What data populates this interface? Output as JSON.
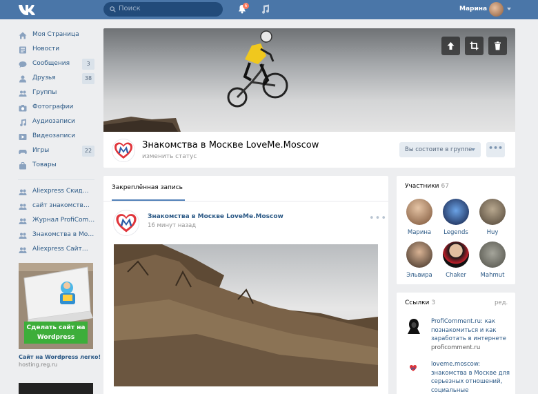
{
  "header": {
    "search_placeholder": "Поиск",
    "notifications_count": "6",
    "user_name": "Марина"
  },
  "left_menu": {
    "items": [
      {
        "label": "Моя Страница",
        "icon": "home-icon",
        "count": ""
      },
      {
        "label": "Новости",
        "icon": "news-icon",
        "count": ""
      },
      {
        "label": "Сообщения",
        "icon": "messages-icon",
        "count": "3"
      },
      {
        "label": "Друзья",
        "icon": "friends-icon",
        "count": "38"
      },
      {
        "label": "Группы",
        "icon": "groups-icon",
        "count": ""
      },
      {
        "label": "Фотографии",
        "icon": "camera-icon",
        "count": ""
      },
      {
        "label": "Аудиозаписи",
        "icon": "audio-icon",
        "count": ""
      },
      {
        "label": "Видеозаписи",
        "icon": "video-icon",
        "count": ""
      },
      {
        "label": "Игры",
        "icon": "gamepad-icon",
        "count": "22"
      },
      {
        "label": "Товары",
        "icon": "bag-icon",
        "count": ""
      }
    ],
    "groups": [
      {
        "label": "Aliexpress Скид…"
      },
      {
        "label": "сайт знакомств…"
      },
      {
        "label": "Журнал ProfiCom…"
      },
      {
        "label": "Знакомства в Мо…"
      },
      {
        "label": "Aliexpress Сайт…"
      }
    ]
  },
  "ad": {
    "button_label": "Сделать сайт на Wordpress",
    "title": "Сайт на Wordpress легко!",
    "url": "hosting.reg.ru"
  },
  "group": {
    "name": "Знакомства в Москве LoveMe.Moscow",
    "status": "изменить статус",
    "member_button": "Вы состоите в группе",
    "more_label": "•••"
  },
  "wall": {
    "tab_label": "Закреплённая запись",
    "post": {
      "author": "Знакомства в Москве LoveMe.Moscow",
      "time": "16 минут назад",
      "menu": "•••"
    }
  },
  "members": {
    "title": "Участники",
    "count": "67",
    "list": [
      {
        "name": "Марина",
        "color": "#c7a27b"
      },
      {
        "name": "Legends",
        "color": "#2a3c8f"
      },
      {
        "name": "Huy",
        "color": "#8a7a66"
      },
      {
        "name": "Эльвира",
        "color": "#6a5a4a"
      },
      {
        "name": "Chaker",
        "color": "#2b2b2b"
      },
      {
        "name": "Mahmut",
        "color": "#7a7a72"
      }
    ]
  },
  "links": {
    "title": "Ссылки",
    "count": "3",
    "edit": "ред.",
    "items": [
      {
        "title": "ProfiComment.ru: как познакомиться и как заработать в интернете",
        "domain": "proficomment.ru"
      },
      {
        "title": "loveme.moscow: знакомства в Москве для серьезных отношений, социальные",
        "domain": ""
      }
    ]
  },
  "colors": {
    "header_bg": "#4a76a8",
    "link": "#2a5885",
    "accent": "#5181b8",
    "ad_button": "#3dae3a",
    "logo_red": "#e0353b",
    "logo_blue": "#2e5ea8"
  }
}
